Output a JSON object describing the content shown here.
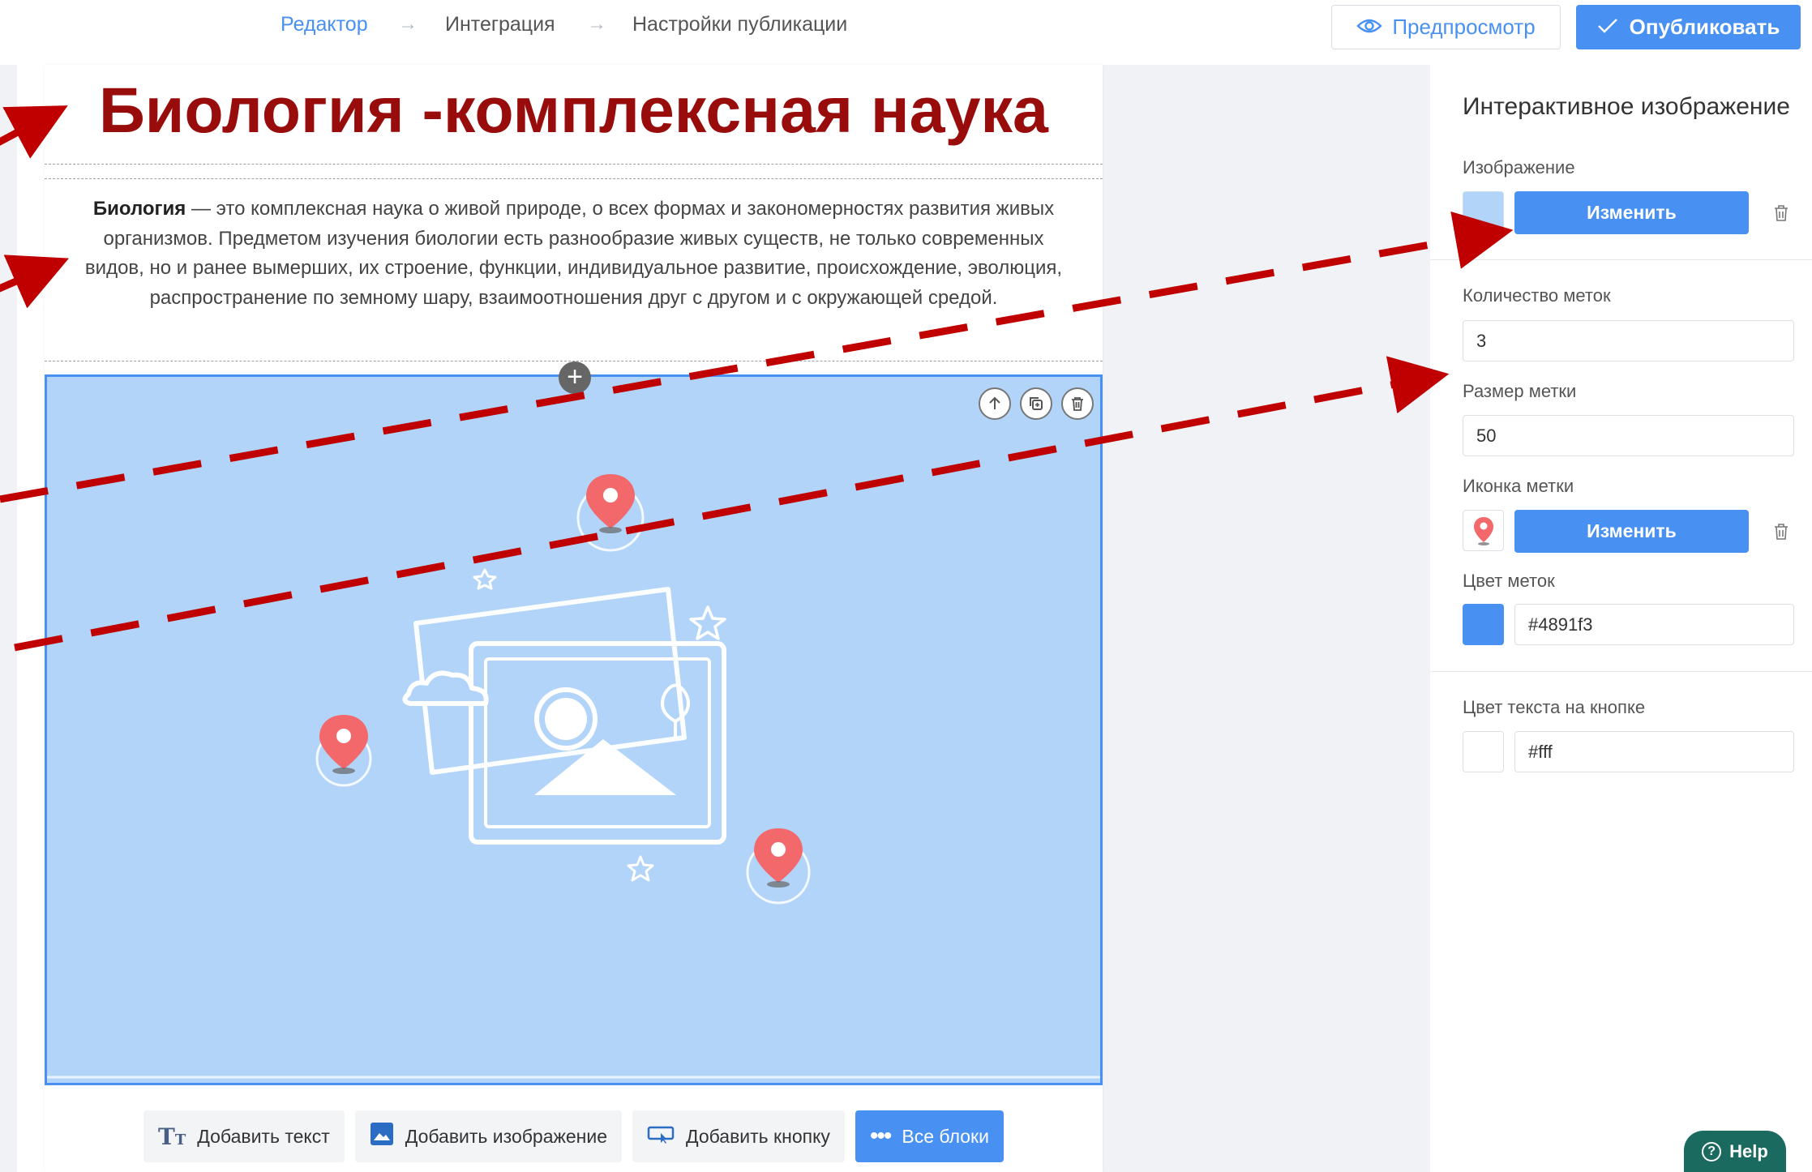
{
  "breadcrumbs": [
    "Редактор",
    "Интеграция",
    "Настройки публикации"
  ],
  "header": {
    "preview_label": "Предпросмотр",
    "publish_label": "Опубликовать"
  },
  "content": {
    "title": "Биология -комплексная наука",
    "paragraph_bold": "Биология",
    "paragraph_rest": " — это комплексная наука о живой природе, о всех формах и закономерностях развития живых организмов. Предметом изучения биологии есть разнообразие живых существ, не только современных видов, но и ранее вымерших, их строение, функции, индивидуальное развитие, происхождение, эволюция, распространение по земному шару, взаимоотношения друг с другом и с окружающей средой."
  },
  "add_bar": {
    "add_text": "Добавить текст",
    "add_image": "Добавить изображение",
    "add_button": "Добавить кнопку",
    "all_blocks": "Все блоки"
  },
  "right_panel": {
    "title": "Интерактивное изображение",
    "image_label": "Изображение",
    "change_label": "Изменить",
    "marker_count_label": "Количество меток",
    "marker_count": "3",
    "marker_size_label": "Размер метки",
    "marker_size": "50",
    "marker_icon_label": "Иконка метки",
    "marker_color_label": "Цвет меток",
    "marker_color": "#4891f3",
    "button_text_color_label": "Цвет текста на кнопке",
    "button_text_color": "#fff"
  },
  "help_label": "Help",
  "colors": {
    "accent": "#4891f3",
    "title_red": "#990c0c",
    "annotation_arrow": "#c00000",
    "image_bg": "#b1d4f8",
    "pin": "#f2686b"
  }
}
